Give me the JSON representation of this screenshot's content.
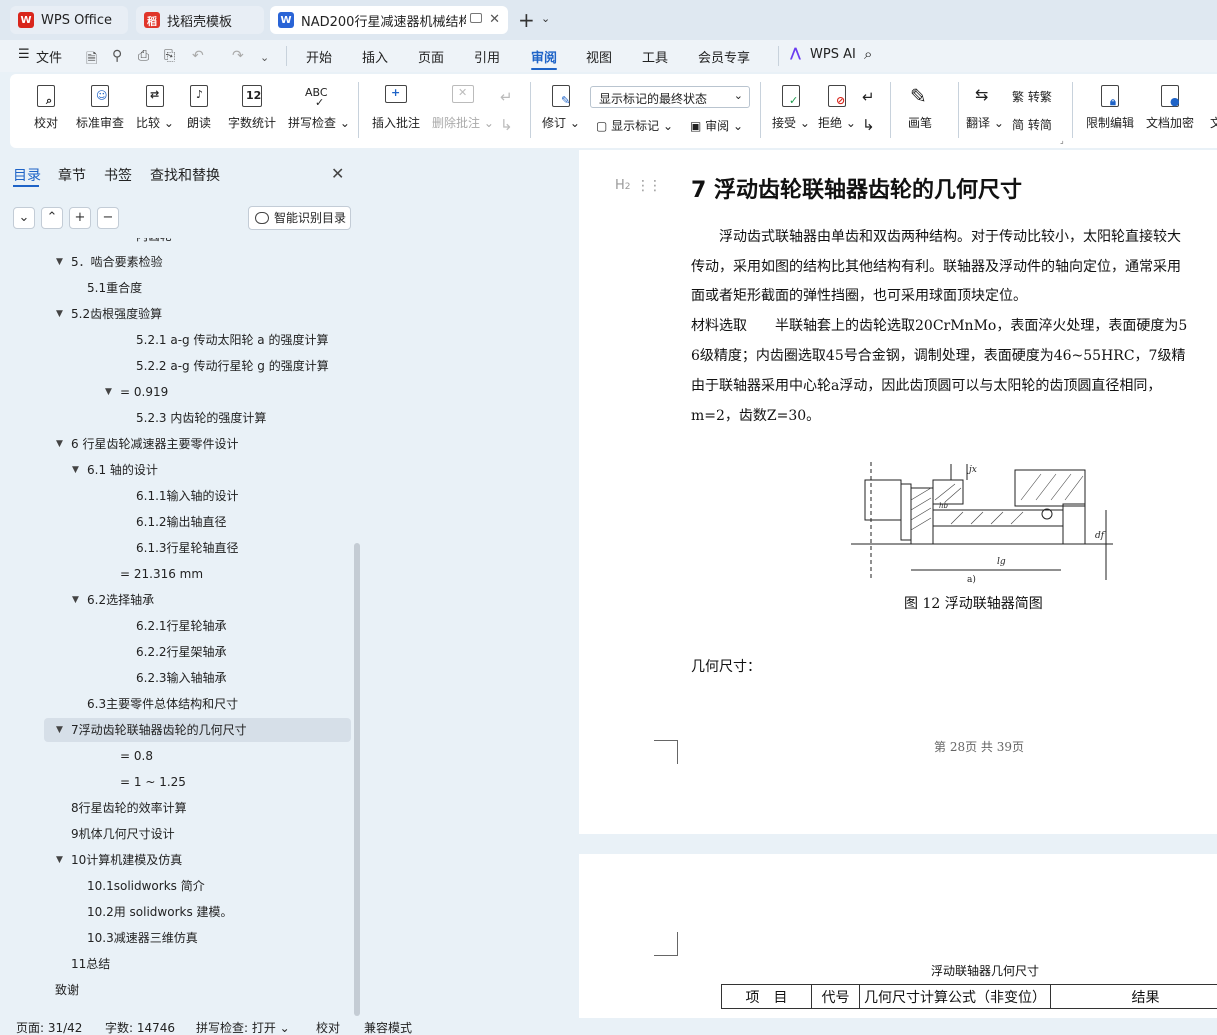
{
  "tabs": {
    "wps_office": "WPS Office",
    "templates": "找稻壳模板",
    "document": "NAD200行星减速器机械结构..."
  },
  "menu": {
    "file": "文件",
    "items": [
      "开始",
      "插入",
      "页面",
      "引用",
      "审阅",
      "视图",
      "工具",
      "会员专享"
    ],
    "active": "审阅",
    "wps_ai": "WPS AI"
  },
  "ribbon": {
    "proofread": "校对",
    "standard_review": "标准审查",
    "compare": "比较",
    "read_aloud": "朗读",
    "word_count": "字数统计",
    "spell_check": "拼写检查",
    "insert_comment": "插入批注",
    "delete_comment": "删除批注",
    "revise": "修订",
    "display_state": "显示标记的最终状态",
    "show_markup": "显示标记",
    "review": "审阅",
    "accept": "接受",
    "reject": "拒绝",
    "pen": "画笔",
    "translate": "翻译",
    "to_traditional": "转繁",
    "to_simplified": "转简",
    "restrict_edit": "限制编辑",
    "doc_encrypt": "文档加密",
    "doc_cut": "文"
  },
  "panel": {
    "tabs": [
      "目录",
      "章节",
      "书签",
      "查找和替换"
    ],
    "smart_toc": "智能识别目录",
    "toc": [
      {
        "text": "内齿轮",
        "arrow": ""
      },
      {
        "text": "5．啮合要素检验",
        "arrow": "▼"
      },
      {
        "text": "5.1重合度",
        "arrow": ""
      },
      {
        "text": "5.2齿根强度验算",
        "arrow": "▼"
      },
      {
        "text": "5.2.1 a-g 传动太阳轮 a 的强度计算",
        "arrow": ""
      },
      {
        "text": "5.2.2 a-g 传动行星轮 g 的强度计算",
        "arrow": ""
      },
      {
        "text": "= 0.919",
        "arrow": "▼"
      },
      {
        "text": "5.2.3 内齿轮的强度计算",
        "arrow": ""
      },
      {
        "text": "6 行星齿轮减速器主要零件设计",
        "arrow": "▼"
      },
      {
        "text": "6.1  轴的设计",
        "arrow": "▼"
      },
      {
        "text": "6.1.1输入轴的设计",
        "arrow": ""
      },
      {
        "text": "6.1.2输出轴直径",
        "arrow": ""
      },
      {
        "text": "6.1.3行星轮轴直径",
        "arrow": ""
      },
      {
        "text": "= 21.316 mm",
        "arrow": ""
      },
      {
        "text": "6.2选择轴承",
        "arrow": "▼"
      },
      {
        "text": "6.2.1行星轮轴承",
        "arrow": ""
      },
      {
        "text": "6.2.2行星架轴承",
        "arrow": ""
      },
      {
        "text": "6.2.3输入轴轴承",
        "arrow": ""
      },
      {
        "text": "6.3主要零件总体结构和尺寸",
        "arrow": ""
      },
      {
        "text": "7浮动齿轮联轴器齿轮的几何尺寸",
        "arrow": "▼"
      },
      {
        "text": "= 0.8",
        "arrow": ""
      },
      {
        "text": "= 1 ~ 1.25",
        "arrow": ""
      },
      {
        "text": "8行星齿轮的效率计算",
        "arrow": ""
      },
      {
        "text": "9机体几何尺寸设计",
        "arrow": ""
      },
      {
        "text": "10计算机建模及仿真",
        "arrow": "▼"
      },
      {
        "text": "10.1solidworks 简介",
        "arrow": ""
      },
      {
        "text": "10.2用 solidworks 建模。",
        "arrow": ""
      },
      {
        "text": "10.3减速器三维仿真",
        "arrow": ""
      },
      {
        "text": "11总结",
        "arrow": ""
      },
      {
        "text": "致谢",
        "arrow": ""
      }
    ]
  },
  "document": {
    "heading": "7 浮动齿轮联轴器齿轮的几何尺寸",
    "heading_style": "H2",
    "paragraphs": [
      "　　浮动齿式联轴器由单齿和双齿两种结构。对于传动比较小，太阳轮直接较大",
      "传动，采用如图的结构比其他结构有利。联轴器及浮动件的轴向定位，通常采用",
      "面或者矩形截面的弹性挡圈，也可采用球面顶块定位。",
      "材料选取　　半联轴套上的齿轮选取20CrMnMo，表面淬火处理，表面硬度为5",
      "6级精度；内齿圈选取45号合金钢，调制处理，表面硬度为46~55HRC，7级精",
      "由于联轴器采用中心轮a浮动，因此齿顶圆可以与太阳轮的齿顶圆直径相同，",
      "m=2，齿数Z=30。"
    ],
    "figure_caption": "图 12 浮动联轴器简图",
    "figure_labels": {
      "jx": "jx",
      "hb": "hb",
      "lg": "lg",
      "a": "a)",
      "d": "df"
    },
    "geometry_label": "几何尺寸：",
    "page_footer": "第 28页 共 39页",
    "table_title": "浮动联轴器几何尺寸",
    "table_headers": [
      "项　目",
      "代号",
      "几何尺寸计算公式（非变位）",
      "结果"
    ]
  },
  "status": {
    "page": "页面: 31/42",
    "words": "字数: 14746",
    "spell": "拼写检查: 打开",
    "proof": "校对",
    "compat": "兼容模式"
  },
  "colors": {
    "accent": "#1e63c7",
    "wps_red": "#d9261c",
    "doc_blue": "#2a64d6"
  }
}
